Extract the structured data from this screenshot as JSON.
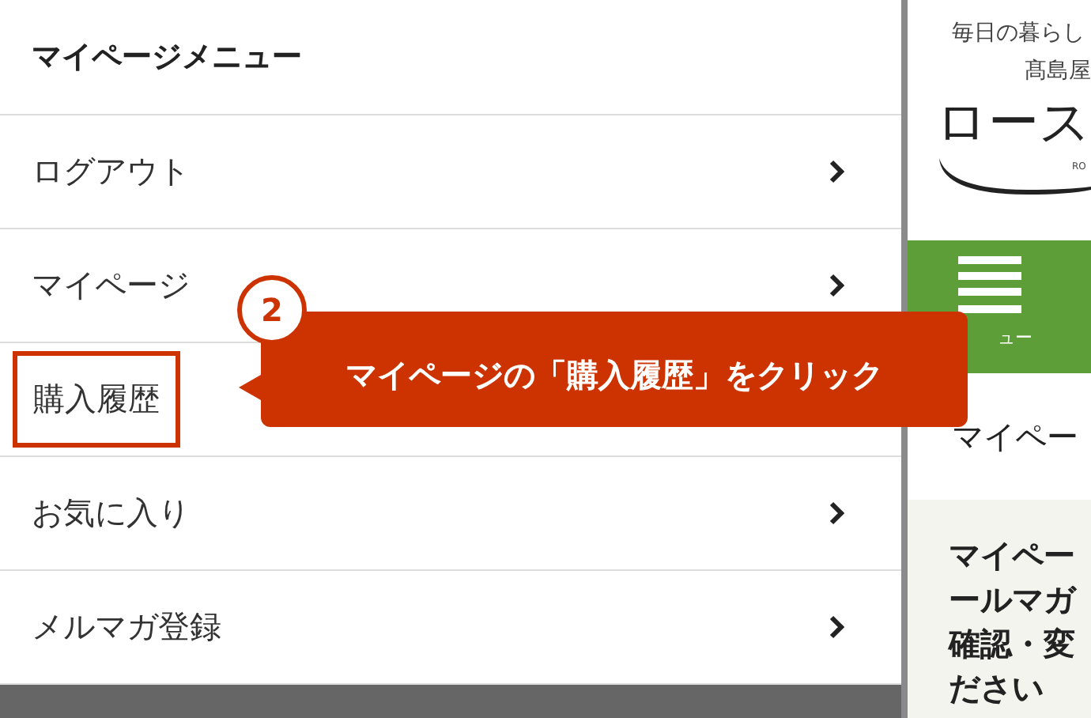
{
  "menu": {
    "title": "マイページメニュー",
    "items": [
      {
        "label": "ログアウト",
        "highlighted": false
      },
      {
        "label": "マイページ",
        "highlighted": false
      },
      {
        "label": "購入履歴",
        "highlighted": true
      },
      {
        "label": "お気に入り",
        "highlighted": false
      },
      {
        "label": "メルマガ登録",
        "highlighted": false
      }
    ]
  },
  "callout": {
    "step": "2",
    "text": "マイページの「購入履歴」をクリック"
  },
  "site": {
    "tagline": "毎日の暮らし",
    "brand": "髙島屋",
    "logo": "ロース",
    "logo_sub": "RO",
    "menu_label": "ュー",
    "heading": "マイペー",
    "body_lines": [
      "マイペー",
      "ールマガ",
      "確認・変",
      "ださい"
    ]
  }
}
